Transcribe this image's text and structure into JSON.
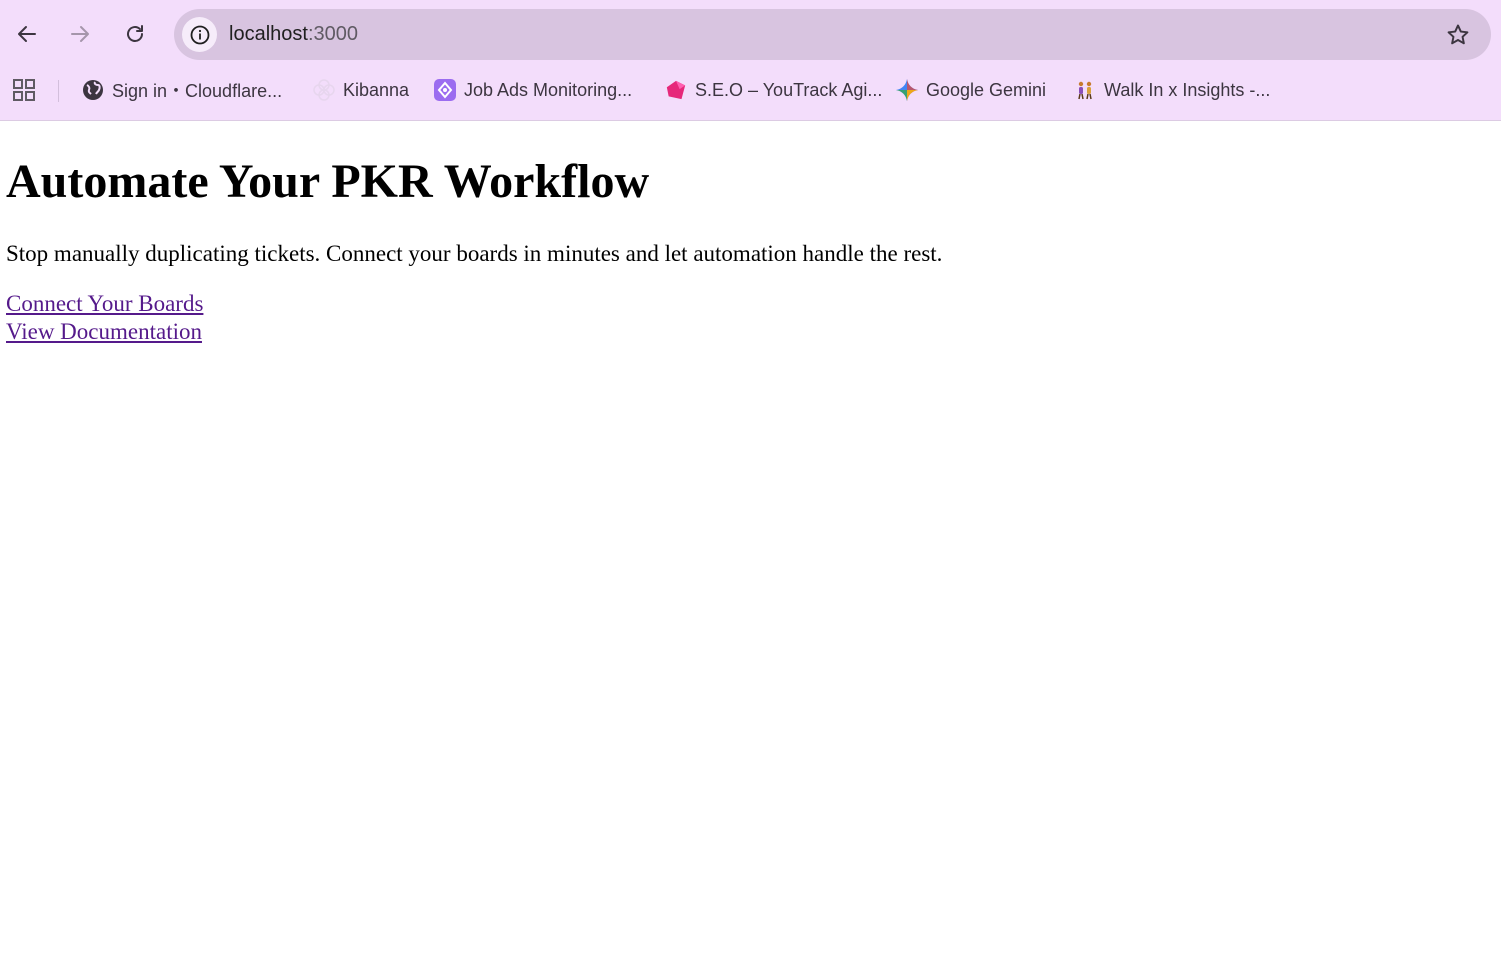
{
  "browser": {
    "address_bar": {
      "host": "localhost",
      "port": ":3000"
    },
    "bookmarks": [
      {
        "label": "Sign in・Cloudflare...",
        "icon": "globe-icon"
      },
      {
        "label": "Kibanna",
        "icon": "flower-icon"
      },
      {
        "label": "Job Ads Monitoring...",
        "icon": "gear-badge-icon"
      },
      {
        "label": "S.E.O – YouTrack Agi...",
        "icon": "youtrack-icon"
      },
      {
        "label": "Google Gemini",
        "icon": "gemini-sparkle-icon"
      },
      {
        "label": "Walk In x Insights -...",
        "icon": "people-walking-icon"
      }
    ],
    "colors": {
      "frame": "#f3ddfb",
      "omnibox": "#d8c4e0",
      "visited_link": "#551a8b"
    }
  },
  "page": {
    "heading": "Automate Your PKR Workflow",
    "lead": "Stop manually duplicating tickets. Connect your boards in minutes and let automation handle the rest.",
    "links": {
      "connect": "Connect Your Boards",
      "docs": "View Documentation"
    }
  }
}
